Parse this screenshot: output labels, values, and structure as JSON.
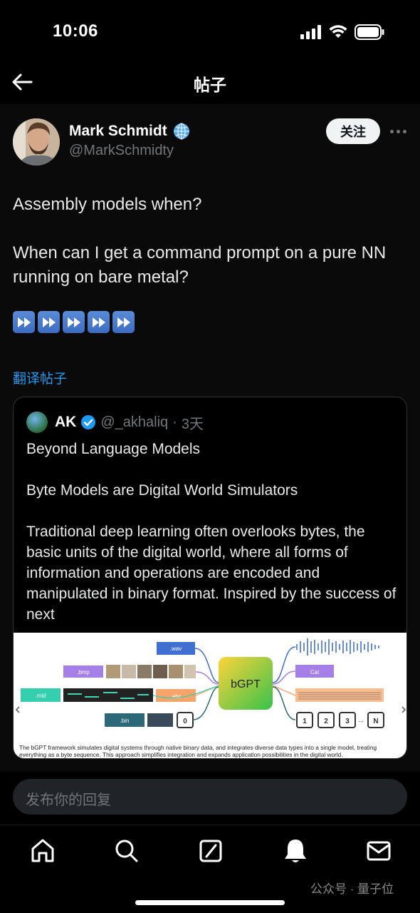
{
  "status_bar": {
    "time": "10:06"
  },
  "nav": {
    "title": "帖子"
  },
  "post": {
    "author_name": "Mark Schmidt",
    "handle": "@MarkSchmidty",
    "follow_label": "关注",
    "paragraphs": [
      "Assembly models when?",
      "When can I get a command prompt on a pure NN running on bare metal?"
    ],
    "emoji": "⏩⏩⏩⏩⏩",
    "translate_label": "翻译帖子"
  },
  "quote": {
    "name": "AK",
    "handle": "@_akhaliq",
    "time": "3天",
    "paragraphs": [
      "Beyond Language Models",
      "Byte Models are Digital World Simulators",
      "Traditional deep learning often overlooks bytes, the basic units of the digital world, where all forms of information and operations are encoded and manipulated in binary format. Inspired by the success of next"
    ],
    "figure": {
      "labels": [
        ".wav",
        ".bmp",
        ".mid",
        ".abc",
        ".bin",
        "bGPT",
        "Cat",
        "0",
        "1",
        "2",
        "3",
        "...",
        "N"
      ],
      "caption": "The bGPT framework simulates digital systems through native binary data, and integrates diverse data types into a single model, treating everything as a byte sequence. This approach simplifies integration and expands application possibilities in the digital world."
    }
  },
  "reply": {
    "placeholder": "发布你的回复"
  },
  "watermark": "公众号 · 量子位",
  "colors": {
    "link": "#1d9bf0",
    "background": "#000000",
    "follow_bg": "#eff3f4"
  }
}
